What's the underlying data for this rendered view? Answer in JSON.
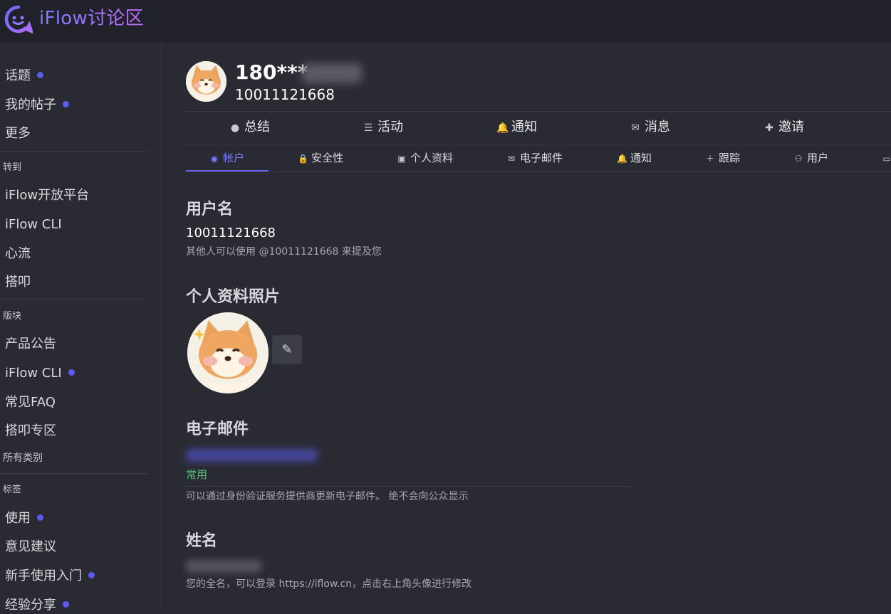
{
  "header": {
    "logo_text": "iFlow讨论区"
  },
  "sidebar": {
    "items_top": [
      {
        "label": "话题",
        "dot": true
      },
      {
        "label": "我的帖子",
        "dot": true
      },
      {
        "label": "更多",
        "dot": false
      }
    ],
    "section_goto": "转到",
    "goto_items": [
      "iFlow开放平台",
      "iFlow CLI",
      "心流",
      "搭叩"
    ],
    "section_categories": "版块",
    "category_items": [
      {
        "label": "产品公告",
        "dot": false
      },
      {
        "label": "iFlow CLI",
        "dot": true
      },
      {
        "label": "常见FAQ",
        "dot": false
      },
      {
        "label": "搭叩专区",
        "dot": false
      }
    ],
    "all_categories": "所有类别",
    "section_tags": "标签",
    "tag_items": [
      {
        "label": "使用",
        "dot": true
      },
      {
        "label": "意见建议",
        "dot": false
      },
      {
        "label": "新手使用入门",
        "dot": true
      },
      {
        "label": "经验分享",
        "dot": true
      }
    ]
  },
  "profile": {
    "display_name": "180***",
    "user_id": "10011121668"
  },
  "primary_tabs": [
    {
      "label": "总结",
      "icon": "person-icon"
    },
    {
      "label": "活动",
      "icon": "list-icon"
    },
    {
      "label": "通知",
      "icon": "bell-icon"
    },
    {
      "label": "消息",
      "icon": "envelope-icon"
    },
    {
      "label": "邀请",
      "icon": "user-plus-icon"
    }
  ],
  "secondary_tabs": [
    {
      "label": "帐户",
      "icon": "user-circle-icon",
      "active": true
    },
    {
      "label": "安全性",
      "icon": "lock-icon",
      "active": false
    },
    {
      "label": "个人资料",
      "icon": "id-card-icon",
      "active": false
    },
    {
      "label": "电子邮件",
      "icon": "envelope-icon",
      "active": false
    },
    {
      "label": "通知",
      "icon": "bell-icon",
      "active": false
    },
    {
      "label": "跟踪",
      "icon": "plus-icon",
      "active": false
    },
    {
      "label": "用户",
      "icon": "users-icon",
      "active": false
    }
  ],
  "account": {
    "username_heading": "用户名",
    "username_value": "10011121668",
    "username_hint": "其他人可以使用 @10011121668 来提及您",
    "photo_heading": "个人资料照片",
    "email_heading": "电子邮件",
    "email_badge": "常用",
    "email_hint": "可以通过身份验证服务提供商更新电子邮件。 绝不会向公众显示",
    "name_heading": "姓名",
    "name_hint": "您的全名，可以登录 https://iflow.cn，点击右上角头像进行修改"
  },
  "colors": {
    "accent": "#6363f5",
    "background": "#2a2a33",
    "topbar": "#21212a",
    "badge_green": "#56c17a"
  }
}
